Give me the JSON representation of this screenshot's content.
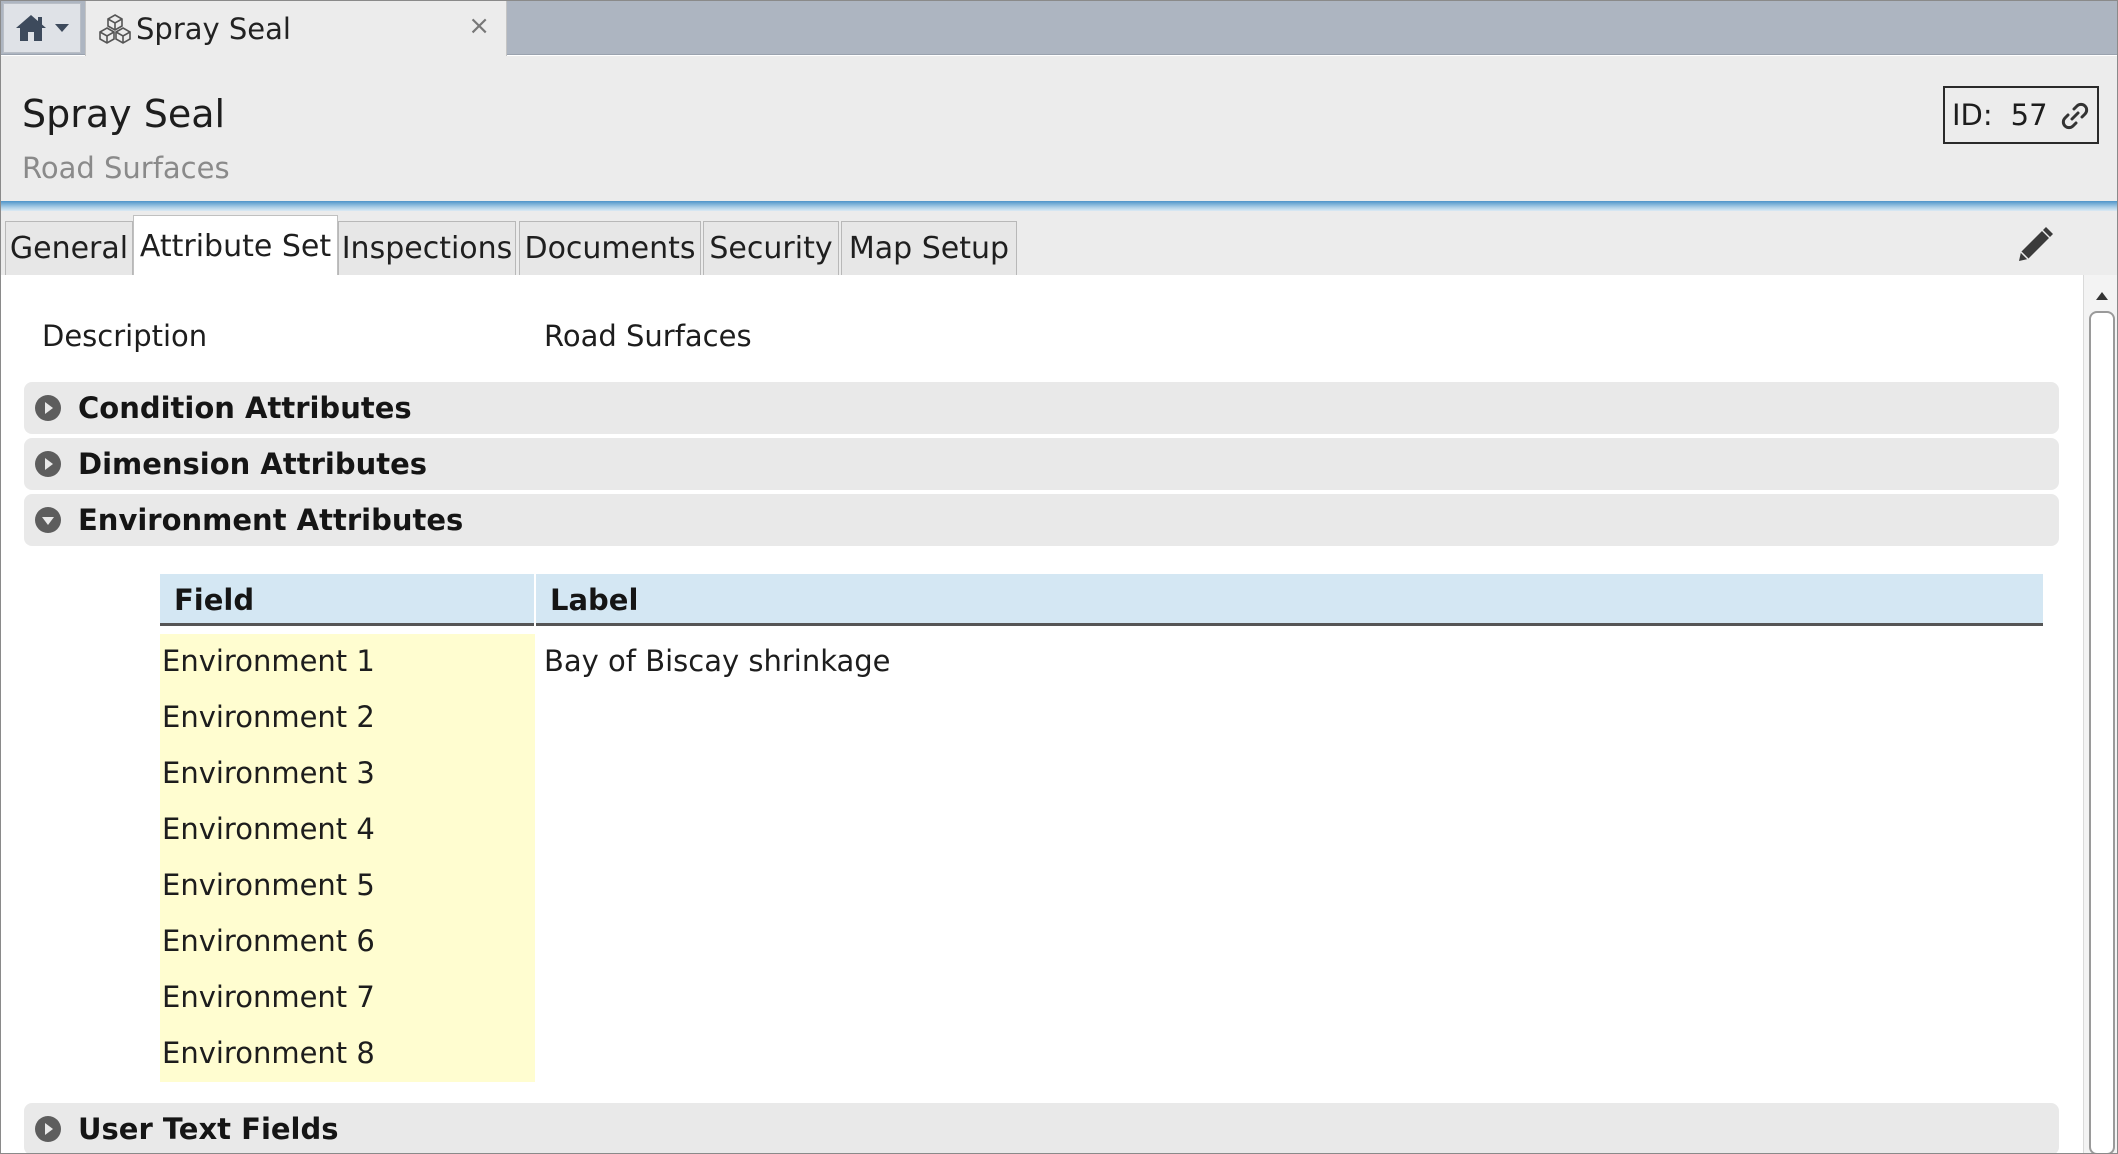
{
  "top_tabs": {
    "home_icon": "home-icon",
    "home_menu_icon": "chevron-down-icon",
    "document_tab": {
      "icon": "cubes-icon",
      "title": "Spray Seal",
      "close_glyph": "×"
    }
  },
  "header": {
    "title": "Spray Seal",
    "subtitle": "Road Surfaces",
    "id_label": "ID:",
    "id_value": "57",
    "link_icon": "link-icon"
  },
  "tabs": [
    {
      "label": "General",
      "active": false
    },
    {
      "label": "Attribute Set",
      "active": true
    },
    {
      "label": "Inspections",
      "active": false
    },
    {
      "label": "Documents",
      "active": false
    },
    {
      "label": "Security",
      "active": false
    },
    {
      "label": "Map Setup",
      "active": false
    }
  ],
  "edit_icon": "pencil-icon",
  "content": {
    "description_label": "Description",
    "description_value": "Road Surfaces",
    "groups": [
      {
        "label": "Condition Attributes",
        "expanded": false
      },
      {
        "label": "Dimension Attributes",
        "expanded": false
      },
      {
        "label": "Environment Attributes",
        "expanded": true
      },
      {
        "label": "User Text Fields",
        "expanded": false
      }
    ],
    "grid": {
      "col_field": "Field",
      "col_label": "Label",
      "rows": [
        {
          "field": "Environment 1",
          "label": "Bay of Biscay shrinkage"
        },
        {
          "field": "Environment 2",
          "label": ""
        },
        {
          "field": "Environment 3",
          "label": ""
        },
        {
          "field": "Environment 4",
          "label": ""
        },
        {
          "field": "Environment 5",
          "label": ""
        },
        {
          "field": "Environment 6",
          "label": ""
        },
        {
          "field": "Environment 7",
          "label": ""
        },
        {
          "field": "Environment 8",
          "label": ""
        }
      ]
    }
  },
  "colors": {
    "accent_blue": "#4e94c9",
    "grid_header": "#d4e7f3",
    "field_highlight": "#fffdd0",
    "topbar": "#adb5c1"
  }
}
